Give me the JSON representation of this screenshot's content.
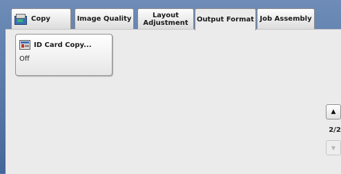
{
  "tabs": [
    {
      "label": "Copy",
      "icon": "copy-machine-icon",
      "active": false
    },
    {
      "label": "Image Quality",
      "active": false
    },
    {
      "label": "Layout\nAdjustment",
      "active": false
    },
    {
      "label": "Output Format",
      "active": true
    },
    {
      "label": "Job Assembly",
      "active": false
    }
  ],
  "feature": {
    "title": "ID Card Copy...",
    "value": "Off",
    "icon": "id-card-icon"
  },
  "pager": {
    "up_symbol": "▲",
    "down_symbol": "▼",
    "page_indicator": "2/2"
  },
  "colors": {
    "frame": "#5a79a6",
    "panel": "#ebebeb",
    "accent_blue": "#3a70b8"
  }
}
